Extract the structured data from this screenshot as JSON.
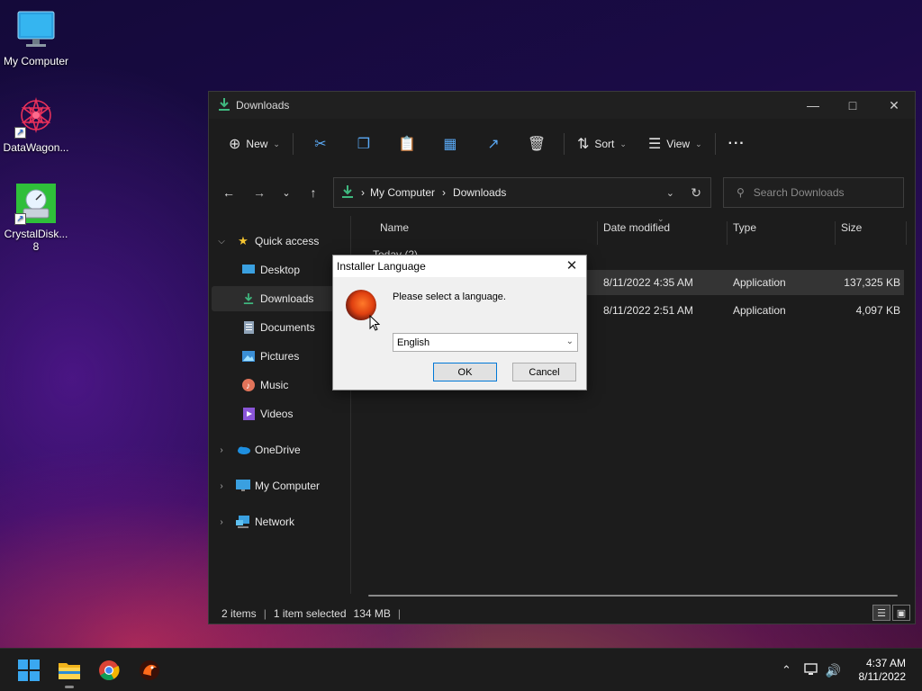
{
  "desktop": {
    "icons": [
      {
        "label": "My Computer"
      },
      {
        "label": "DataWagon..."
      },
      {
        "label": "CrystalDisk... 8"
      }
    ]
  },
  "explorer": {
    "title": "Downloads",
    "toolbar": {
      "new_label": "New",
      "sort_label": "Sort",
      "view_label": "View",
      "more_label": "···"
    },
    "address": {
      "crumbs": [
        "My Computer",
        "Downloads"
      ],
      "search_placeholder": "Search Downloads"
    },
    "sidebar": {
      "quick_access": "Quick access",
      "items": [
        "Desktop",
        "Downloads",
        "Documents",
        "Pictures",
        "Music",
        "Videos"
      ],
      "roots": [
        "OneDrive",
        "My Computer",
        "Network"
      ]
    },
    "columns": [
      "Name",
      "Date modified",
      "Type",
      "Size"
    ],
    "group_label": "Today (2)",
    "files": [
      {
        "date": "8/11/2022 4:35 AM",
        "type": "Application",
        "size": "137,325 KB"
      },
      {
        "date": "8/11/2022 2:51 AM",
        "type": "Application",
        "size": "4,097 KB"
      }
    ],
    "status": {
      "items": "2 items",
      "selected": "1 item selected",
      "size": "134 MB"
    }
  },
  "dialog": {
    "title": "Installer Language",
    "message": "Please select a language.",
    "selected_language": "English",
    "ok_label": "OK",
    "cancel_label": "Cancel"
  },
  "taskbar": {
    "time": "4:37 AM",
    "date": "8/11/2022"
  },
  "colors": {
    "accent": "#0078d7",
    "explorer_bg": "#1c1c1c",
    "download_green": "#3fb87f"
  }
}
